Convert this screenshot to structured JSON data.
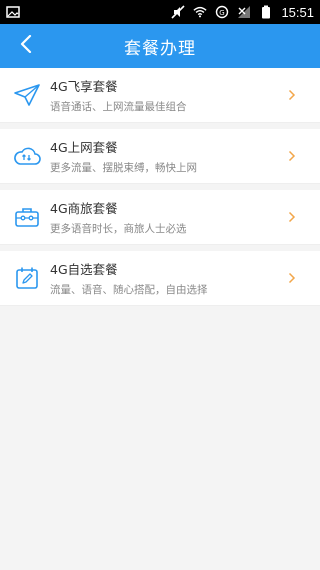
{
  "status_bar": {
    "time": "15:51",
    "icons": [
      "image-icon",
      "no-sound-icon",
      "wifi-icon",
      "data-icon",
      "signal-off-icon",
      "battery-icon"
    ]
  },
  "header": {
    "title": "套餐办理",
    "back_icon": "chevron-left-icon"
  },
  "list": {
    "items": [
      {
        "title": "4G飞享套餐",
        "subtitle": "语音通话、上网流量最佳组合",
        "icon": "paper-plane-icon"
      },
      {
        "title": "4G上网套餐",
        "subtitle": "更多流量、摆脱束缚，畅快上网",
        "icon": "cloud-arrows-icon"
      },
      {
        "title": "4G商旅套餐",
        "subtitle": "更多语音时长，商旅人士必选",
        "icon": "suitcase-icon"
      },
      {
        "title": "4G自选套餐",
        "subtitle": "流量、语音、随心搭配，自由选择",
        "icon": "calendar-pen-icon"
      }
    ]
  },
  "colors": {
    "header_blue": "#2b97ef",
    "icon_blue": "#2b97ef",
    "chevron_orange": "#f2a64a"
  }
}
